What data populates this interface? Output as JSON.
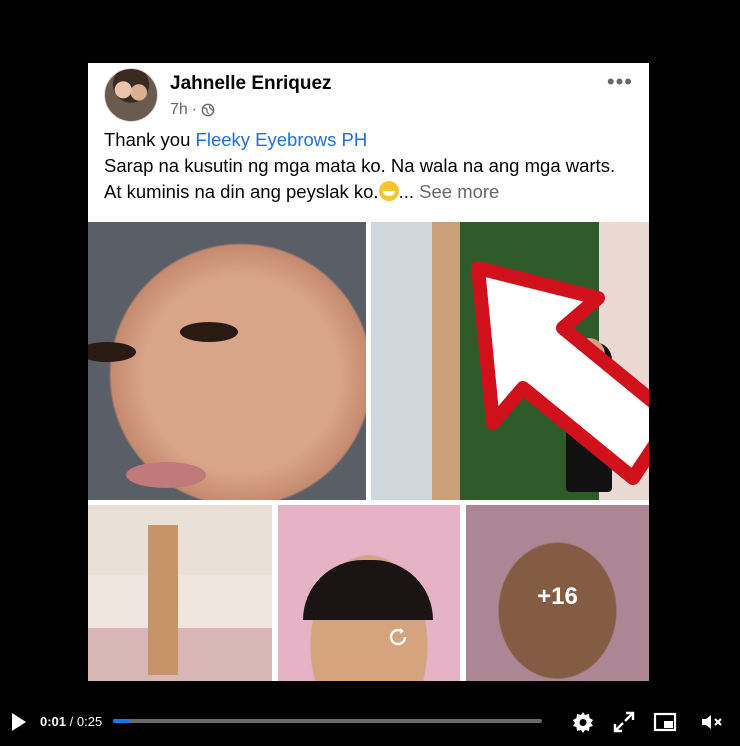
{
  "post": {
    "author": "Jahnelle Enriquez",
    "time": "7h",
    "dot": "·",
    "more_label": "•••",
    "text_prefix": "Thank you ",
    "mention": "Fleeky Eyebrows PH",
    "text_body": "Sarap na kusutin ng mga mata ko. Na wala na ang mga warts. At kuminis na din ang peyslak ko.",
    "ellipsis": "...",
    "see_more": "See more",
    "more_photos": "+16"
  },
  "player": {
    "current_time": "0:01",
    "separator": " / ",
    "duration": "0:25",
    "progress": 0.04,
    "icons": [
      "play-icon",
      "settings-icon",
      "fullscreen-icon",
      "picture-in-picture-icon",
      "mute-icon"
    ]
  },
  "colors": {
    "link": "#216fdb",
    "progress_fill": "#1877f2",
    "arrow": "#d0111b"
  }
}
